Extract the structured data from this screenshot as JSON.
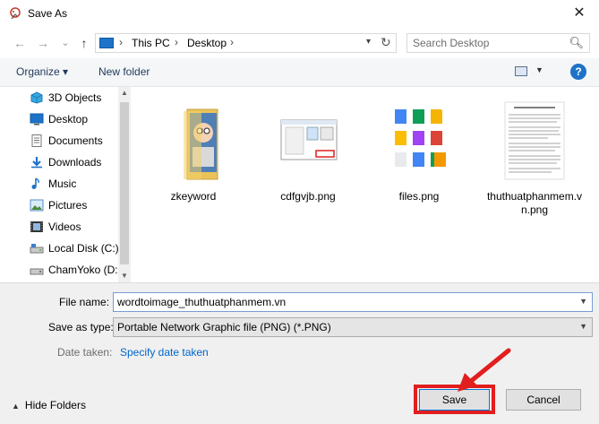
{
  "window": {
    "title": "Save As",
    "close_glyph": "✕"
  },
  "nav": {
    "back_glyph": "←",
    "forward_glyph": "→",
    "recent_glyph": "⌄",
    "up_glyph": "↑",
    "breadcrumbs": [
      "This PC",
      "Desktop"
    ],
    "breadcrumb_sep": "›",
    "refresh_glyph": "↻",
    "search_placeholder": "Search Desktop"
  },
  "toolbar": {
    "organize_label": "Organize ▾",
    "new_folder_label": "New folder",
    "help_label": "?"
  },
  "sidebar": {
    "items": [
      {
        "label": "3D Objects",
        "icon": "cube-icon"
      },
      {
        "label": "Desktop",
        "icon": "desktop-icon"
      },
      {
        "label": "Documents",
        "icon": "documents-icon"
      },
      {
        "label": "Downloads",
        "icon": "download-icon"
      },
      {
        "label": "Music",
        "icon": "music-icon"
      },
      {
        "label": "Pictures",
        "icon": "pictures-icon"
      },
      {
        "label": "Videos",
        "icon": "videos-icon"
      },
      {
        "label": "Local Disk (C:)",
        "icon": "disk-icon"
      },
      {
        "label": "ChamYoko (D:",
        "icon": "drive-icon"
      }
    ]
  },
  "files": [
    {
      "name": "zkeyword",
      "type": "folder"
    },
    {
      "name": "cdfgvjb.png",
      "type": "image"
    },
    {
      "name": "files.png",
      "type": "image"
    },
    {
      "name": "thuthuatphanmem.vn.png",
      "type": "image"
    }
  ],
  "form": {
    "file_name_label": "File name:",
    "file_name_value": "wordtoimage_thuthuatphanmem.vn",
    "save_type_label": "Save as type:",
    "save_type_value": "Portable Network Graphic file (PNG) (*.PNG)",
    "date_taken_label": "Date taken:",
    "date_taken_link": "Specify date taken"
  },
  "footer": {
    "hide_folders_label": "Hide Folders",
    "save_label": "Save",
    "cancel_label": "Cancel"
  },
  "colors": {
    "accent": "#0078d7",
    "highlight_red": "#e21e1e",
    "link": "#0066cc"
  }
}
